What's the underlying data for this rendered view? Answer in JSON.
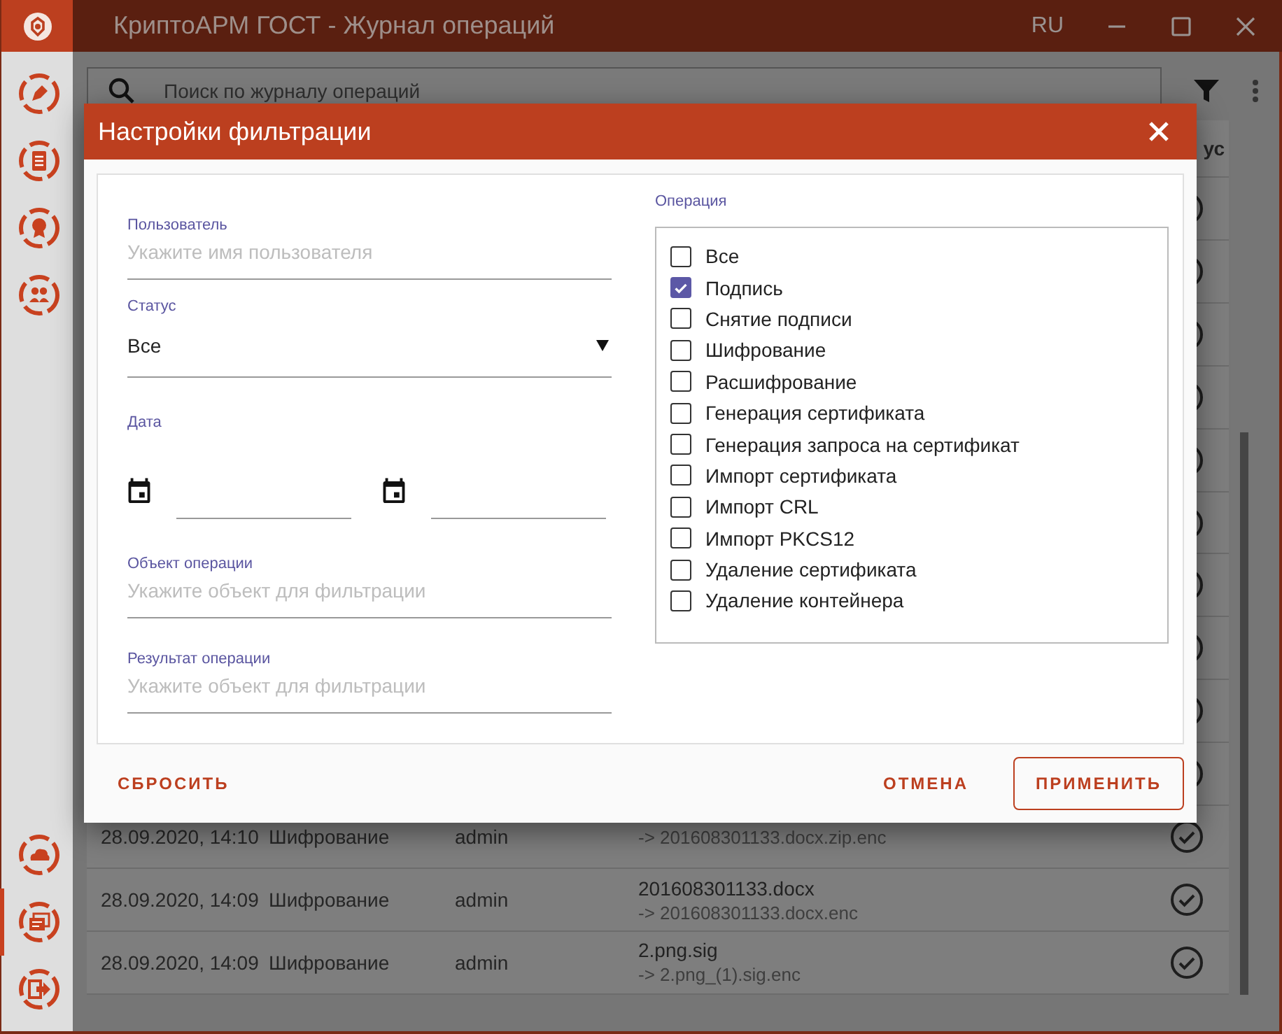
{
  "window": {
    "title": "КриптоАРМ ГОСТ - Журнал операций",
    "language": "RU"
  },
  "sidebar": {
    "top_items": [
      {
        "kind": "sign",
        "selected": false
      },
      {
        "kind": "document",
        "selected": false
      },
      {
        "kind": "certificate",
        "selected": false
      },
      {
        "kind": "contacts",
        "selected": false
      }
    ],
    "bottom_items": [
      {
        "kind": "cloud",
        "selected": false
      },
      {
        "kind": "journal",
        "selected": true
      },
      {
        "kind": "exit",
        "selected": false
      }
    ]
  },
  "search": {
    "placeholder": "Поиск по журналу операций"
  },
  "table": {
    "header": "ус",
    "rows": [
      {
        "success": true
      },
      {
        "success": true
      },
      {
        "success": true
      },
      {
        "success": true
      },
      {
        "success": true
      },
      {
        "success": true
      },
      {
        "success": true
      },
      {
        "success": true
      },
      {
        "success": true
      },
      {
        "success": true
      },
      {
        "success": true,
        "date": "28.09.2020, 14:10",
        "operation": "Шифрование",
        "user": "admin",
        "target": "-> 201608301133.docx.zip.enc"
      },
      {
        "success": true,
        "date": "28.09.2020, 14:09",
        "operation": "Шифрование",
        "user": "admin",
        "file": "201608301133.docx",
        "target": "-> 201608301133.docx.enc"
      },
      {
        "success": true,
        "date": "28.09.2020, 14:09",
        "operation": "Шифрование",
        "user": "admin",
        "file": "2.png.sig",
        "target": "-> 2.png_(1).sig.enc"
      }
    ]
  },
  "dialog": {
    "title": "Настройки фильтрации",
    "fields": [
      {
        "kind": "text",
        "label": "Пользователь",
        "placeholder": "Укажите имя пользователя"
      },
      {
        "kind": "select",
        "label": "Статус",
        "value": "Все"
      },
      {
        "kind": "dates",
        "label": "Дата"
      },
      {
        "kind": "text",
        "label": "Объект операции",
        "placeholder": "Укажите объект для фильтрации"
      },
      {
        "kind": "text",
        "label": "Результат операции",
        "placeholder": "Укажите объект для фильтрации"
      }
    ],
    "operations_label": "Операция",
    "operations": [
      {
        "label": "Все",
        "checked": false
      },
      {
        "label": "Подпись",
        "checked": true
      },
      {
        "label": "Снятие подписи",
        "checked": false
      },
      {
        "label": "Шифрование",
        "checked": false
      },
      {
        "label": "Расшифрование",
        "checked": false
      },
      {
        "label": "Генерация сертификата",
        "checked": false
      },
      {
        "label": "Генерация запроса на сертификат",
        "checked": false
      },
      {
        "label": "Импорт сертификата",
        "checked": false
      },
      {
        "label": "Импорт CRL",
        "checked": false
      },
      {
        "label": "Импорт PKCS12",
        "checked": false
      },
      {
        "label": "Удаление сертификата",
        "checked": false
      },
      {
        "label": "Удаление контейнера",
        "checked": false
      }
    ],
    "reset_button": "СБРОСИТЬ",
    "buttons": [
      {
        "label": "ОТМЕНА",
        "kind": "text"
      },
      {
        "label": "ПРИМЕНИТЬ",
        "kind": "outlined"
      }
    ]
  }
}
